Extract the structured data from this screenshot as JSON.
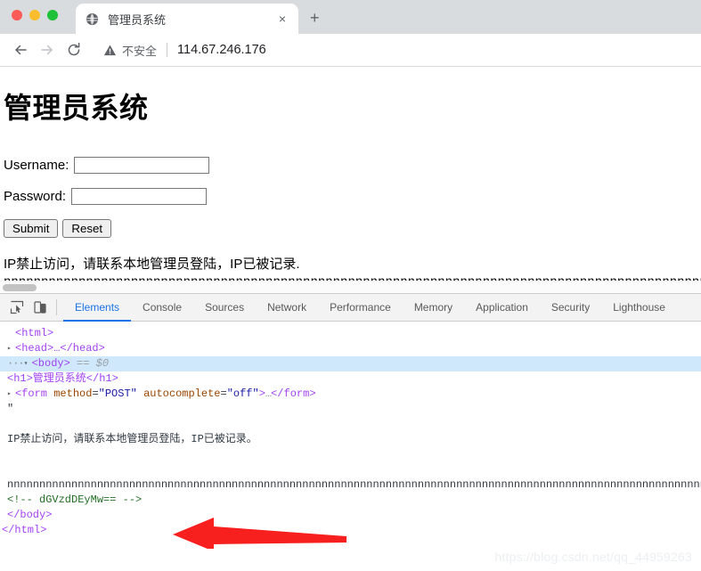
{
  "browser": {
    "window_controls": [
      "close",
      "minimize",
      "maximize"
    ],
    "tab": {
      "favicon": "globe-icon",
      "title": "管理员系统",
      "close_label": "×"
    },
    "new_tab_label": "+",
    "nav": {
      "back": "←",
      "forward": "→",
      "reload": "⟳"
    },
    "omnibox": {
      "security_icon": "warning-triangle-icon",
      "security_label": "不安全",
      "url": "114.67.246.176"
    }
  },
  "page": {
    "heading": "管理员系统",
    "form": {
      "username_label": "Username:",
      "username_value": "",
      "password_label": "Password:",
      "password_value": "",
      "submit_label": "Submit",
      "reset_label": "Reset"
    },
    "message": "IP禁止访问，请联系本地管理员登陆，IP已被记录.",
    "filler": "nnnnnnnnnnnnnnnnnnnnnnnnnnnnnnnnnnnnnnnnnnnnnnnnnnnnnnnnnnnnnnnnnnnnnnnnnnnnnnnnnnnnnnnnnnnnnnnnnnnnnnnnnnnnnnnnnnnnnnnnnnnnnn"
  },
  "devtools": {
    "toolbar_icons": [
      "inspect-element-icon",
      "device-toolbar-icon"
    ],
    "tabs": [
      {
        "label": "Elements",
        "active": true
      },
      {
        "label": "Console",
        "active": false
      },
      {
        "label": "Sources",
        "active": false
      },
      {
        "label": "Network",
        "active": false
      },
      {
        "label": "Performance",
        "active": false
      },
      {
        "label": "Memory",
        "active": false
      },
      {
        "label": "Application",
        "active": false
      },
      {
        "label": "Security",
        "active": false
      },
      {
        "label": "Lighthouse",
        "active": false
      }
    ],
    "dom": {
      "line_html_open": "<html>",
      "line_head": "<head>…</head>",
      "line_body_open": "<body>",
      "line_body_marker": "== $0",
      "line_h1": "<h1>管理员系统</h1>",
      "line_form": "<form method=\"POST\" autocomplete=\"off\">…</form>",
      "form_tag": "form",
      "form_attr1_name": "method",
      "form_attr1_value": "POST",
      "form_attr2_name": "autocomplete",
      "form_attr2_value": "off",
      "line_quote": "\"",
      "line_text_message": "IP禁止访问，请联系本地管理员登陆，IP已被记录。",
      "line_filler": "nnnnnnnnnnnnnnnnnnnnnnnnnnnnnnnnnnnnnnnnnnnnnnnnnnnnnnnnnnnnnnnnnnnnnnnnnnnnnnnnnnnnnnnnnnnnnnnnnnnnnnnnnnnnnnnnnnnnnnnnnnnnnnnnnnnnnnnnnnnnnnnnnnnnnnnn",
      "line_comment": "<!-- dGVzdDEyMw== -->",
      "line_body_close": "</body>",
      "line_html_close": "</html>"
    }
  },
  "annotation": {
    "arrow": "red-left-arrow",
    "arrow_color": "#f81f1f"
  },
  "watermark": "https://blog.csdn.net/qq_44959263"
}
